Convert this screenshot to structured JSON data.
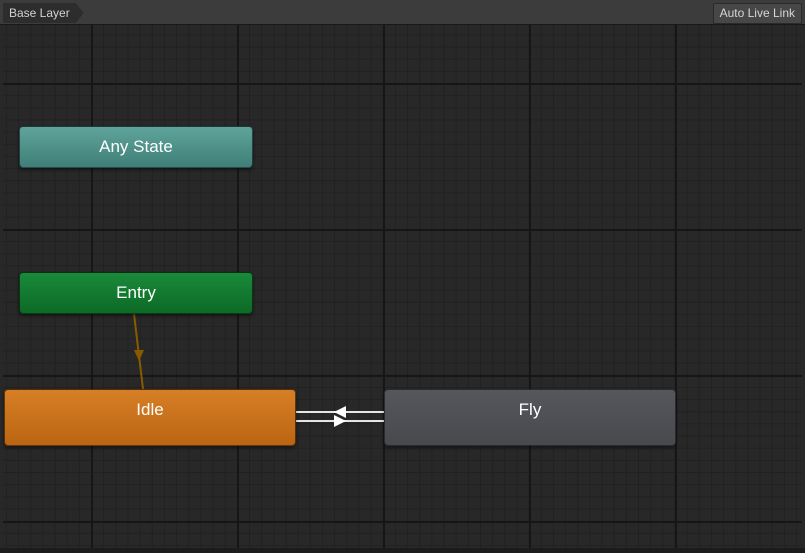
{
  "toolbar": {
    "breadcrumb": "Base Layer",
    "live_link_label": "Auto Live Link"
  },
  "states": {
    "any_state": "Any State",
    "entry": "Entry",
    "idle": "Idle",
    "fly": "Fly"
  },
  "colors": {
    "any_state": "#4f928a",
    "entry": "#127a30",
    "idle_default": "#c9711c",
    "fly": "#4e5054",
    "entry_transition": "#8a5a00",
    "state_transition": "#e6e6e6"
  }
}
